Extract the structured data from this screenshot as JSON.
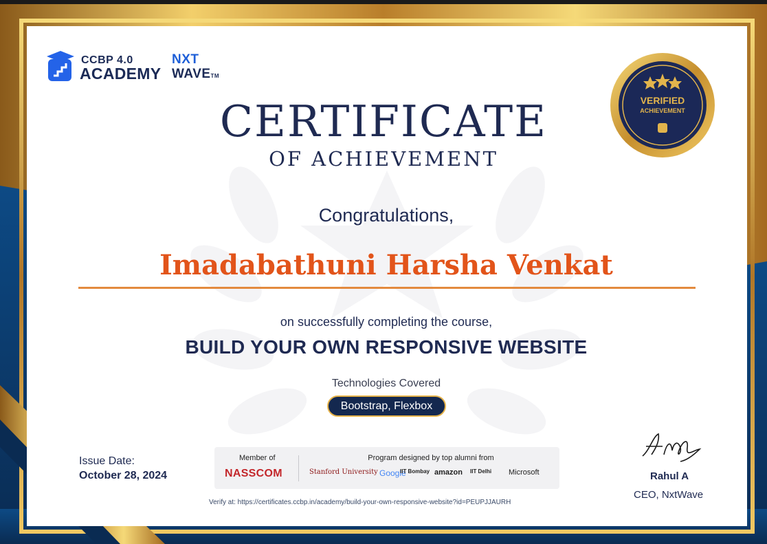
{
  "branding": {
    "ccbp_top": "CCBP 4.0",
    "ccbp_bottom": "ACADEMY",
    "nxt_top": "NXT",
    "nxt_bottom": "WAVE",
    "tm": "TM"
  },
  "title": "CERTIFICATE",
  "subtitle": "OF ACHIEVEMENT",
  "greeting": "Congratulations,",
  "recipient_name": "Imadabathuni Harsha Venkat",
  "completion_text": "on successfully completing the course,",
  "course_name": "BUILD YOUR OWN RESPONSIVE WEBSITE",
  "technologies_label": "Technologies Covered",
  "technologies": "Bootstrap, Flexbox",
  "issue_label": "Issue Date:",
  "issue_date": "October 28, 2024",
  "seal": {
    "line1": "VERIFIED",
    "line2": "ACHIEVEMENT"
  },
  "partners": {
    "member_label": "Member of",
    "member_org": "NASSCOM",
    "program_label": "Program designed by top alumni from",
    "logos": [
      "Stanford University",
      "Google",
      "IIT Bombay",
      "amazon",
      "IIT Delhi",
      "Microsoft"
    ]
  },
  "verify_text": "Verify at: https://certificates.ccbp.in/academy/build-your-own-responsive-website?id=PEUPJJAURH",
  "signatory": {
    "name": "Rahul A",
    "title": "CEO, NxtWave",
    "signature_text": "Ahdy"
  },
  "colors": {
    "navy": "#1f2a52",
    "blue": "#0d3b6e",
    "gold": "#e2b44c",
    "orange": "#e2541a"
  }
}
